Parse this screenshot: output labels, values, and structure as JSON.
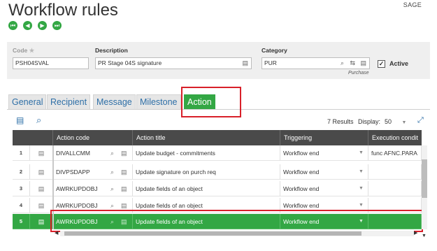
{
  "app": {
    "title": "Workflow rules",
    "brand": "SAGE"
  },
  "nav_buttons": [
    "first-record",
    "previous-record",
    "next-record",
    "last-record"
  ],
  "form": {
    "code": {
      "label": "Code",
      "value": "PSH04SVAL"
    },
    "description": {
      "label": "Description",
      "value": "PR Stage 04S signature"
    },
    "category": {
      "label": "Category",
      "value": "PUR",
      "hint": "Purchase"
    },
    "active": {
      "label": "Active",
      "checked": true
    }
  },
  "tabs": [
    {
      "label": "General",
      "active": false
    },
    {
      "label": "Recipient",
      "active": false
    },
    {
      "label": "Message",
      "active": false
    },
    {
      "label": "Milestone",
      "active": false
    },
    {
      "label": "Action",
      "active": true
    }
  ],
  "grid": {
    "results": "7 Results",
    "display_label": "Display:",
    "display_value": "50",
    "columns": [
      "Action code",
      "Action title",
      "Triggering",
      "Execution condit"
    ],
    "rows": [
      {
        "num": "1",
        "code": "DIVALLCMM",
        "title": "Update budget - commitments",
        "triggering": "Workflow end",
        "condition": "func AFNC.PARA"
      },
      {
        "num": "2",
        "code": "DIVPSDAPP",
        "title": "Update signature on purch req",
        "triggering": "Workflow end",
        "condition": ""
      },
      {
        "num": "3",
        "code": "AWRKUPDOBJ",
        "title": "Update fields of an object",
        "triggering": "Workflow end",
        "condition": ""
      },
      {
        "num": "4",
        "code": "AWRKUPDOBJ",
        "title": "Update fields of an object",
        "triggering": "Workflow end",
        "condition": ""
      },
      {
        "num": "5",
        "code": "AWRKUPDOBJ",
        "title": "Update fields of an object",
        "triggering": "Workflow end",
        "condition": ""
      }
    ],
    "selected_row": 5
  },
  "colors": {
    "accent": "#33a744",
    "highlight": "#d8202a",
    "header": "#4a4a4a",
    "link": "#2e6fa7"
  }
}
